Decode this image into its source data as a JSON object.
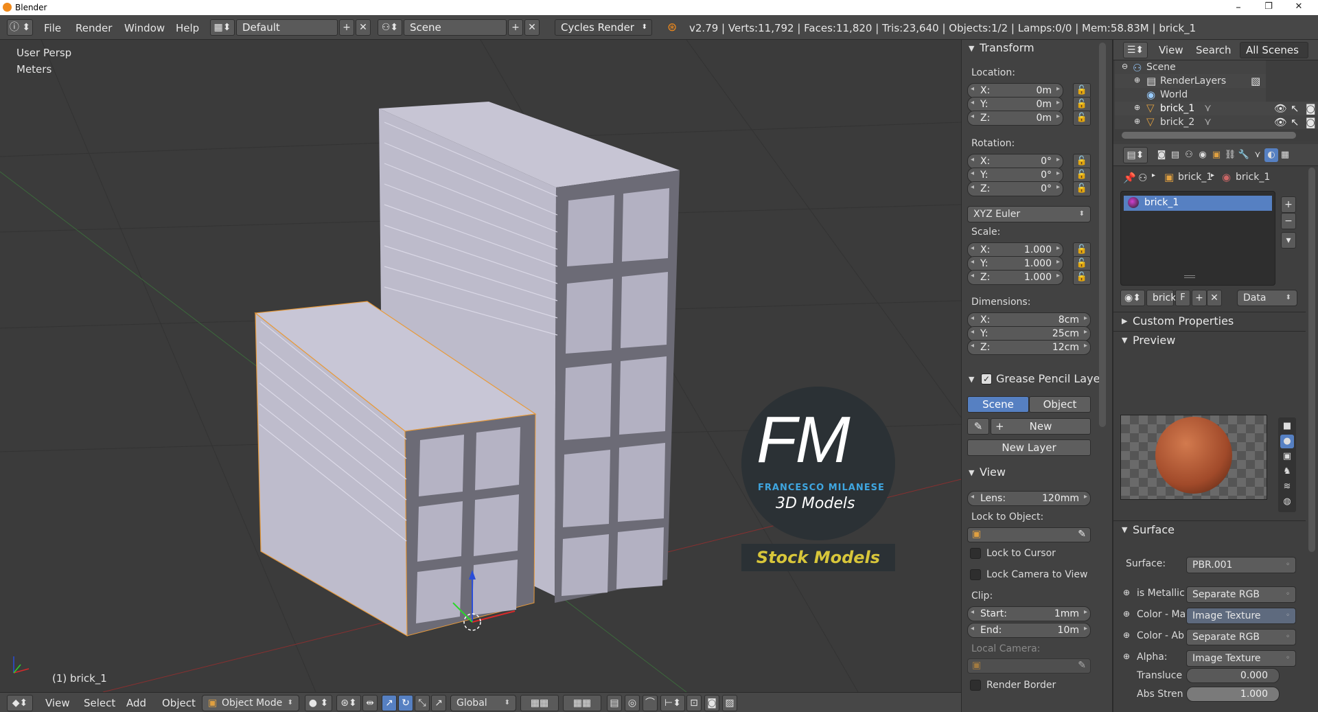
{
  "window": {
    "title": "Blender",
    "min": "–",
    "max": "❐",
    "close": "✕"
  },
  "menu": {
    "file": "File",
    "render": "Render",
    "window": "Window",
    "help": "Help"
  },
  "layout": {
    "value": "Default"
  },
  "scene": {
    "value": "Scene"
  },
  "engine": {
    "value": "Cycles Render"
  },
  "stats": "v2.79 | Verts:11,792 | Faces:11,820 | Tris:23,640 | Objects:1/2 | Lamps:0/0 | Mem:58.83M | brick_1",
  "viewport": {
    "view_name": "User Persp",
    "units": "Meters",
    "object_label": "(1) brick_1"
  },
  "watermark": {
    "logo": "FM",
    "name": "FRANCESCO MILANESE",
    "tagline": "3D Models",
    "stock": "Stock Models"
  },
  "bottombar": {
    "view": "View",
    "select": "Select",
    "add": "Add",
    "object": "Object",
    "mode": "Object Mode",
    "orientation": "Global"
  },
  "transform": {
    "header": "Transform",
    "location_label": "Location:",
    "location": [
      {
        "k": "X:",
        "v": "0m"
      },
      {
        "k": "Y:",
        "v": "0m"
      },
      {
        "k": "Z:",
        "v": "0m"
      }
    ],
    "rotation_label": "Rotation:",
    "rotation": [
      {
        "k": "X:",
        "v": "0°"
      },
      {
        "k": "Y:",
        "v": "0°"
      },
      {
        "k": "Z:",
        "v": "0°"
      }
    ],
    "rotation_mode": "XYZ Euler",
    "scale_label": "Scale:",
    "scale": [
      {
        "k": "X:",
        "v": "1.000"
      },
      {
        "k": "Y:",
        "v": "1.000"
      },
      {
        "k": "Z:",
        "v": "1.000"
      }
    ],
    "dimensions_label": "Dimensions:",
    "dimensions": [
      {
        "k": "X:",
        "v": "8cm"
      },
      {
        "k": "Y:",
        "v": "25cm"
      },
      {
        "k": "Z:",
        "v": "12cm"
      }
    ]
  },
  "grease": {
    "header": "Grease Pencil Layer",
    "scene_btn": "Scene",
    "object_btn": "Object",
    "new_btn": "New",
    "new_layer": "New Layer"
  },
  "viewpanel": {
    "header": "View",
    "lens_k": "Lens:",
    "lens_v": "120mm",
    "lock_obj": "Lock to Object:",
    "lock_cursor": "Lock to Cursor",
    "lock_camera": "Lock Camera to View",
    "clip": "Clip:",
    "start_k": "Start:",
    "start_v": "1mm",
    "end_k": "End:",
    "end_v": "10m",
    "local_camera": "Local Camera:",
    "render_border": "Render Border"
  },
  "outliner": {
    "view": "View",
    "search": "Search",
    "filter": "All Scenes",
    "items": [
      "Scene",
      "RenderLayers",
      "World",
      "brick_1",
      "brick_2"
    ]
  },
  "props": {
    "crumb1": "brick_1",
    "crumb2": "brick_1",
    "material_slot": "brick_1",
    "mat_name": "brick_",
    "mat_f": "F",
    "link": "Data",
    "custom_props": "Custom Properties",
    "preview": "Preview",
    "surface_header": "Surface",
    "surface": [
      {
        "k": "Surface:",
        "v": "PBR.001"
      },
      {
        "k": "is Metallic",
        "v": "Separate RGB"
      },
      {
        "k": "Color - Ma",
        "v": "Image Texture"
      },
      {
        "k": "Color - Ab",
        "v": "Separate RGB"
      },
      {
        "k": "Alpha:",
        "v": "Image Texture"
      }
    ],
    "translucency_k": "Transluce",
    "translucency_v": "0.000",
    "abs_k": "Abs Stren",
    "abs_v": "1.000"
  }
}
